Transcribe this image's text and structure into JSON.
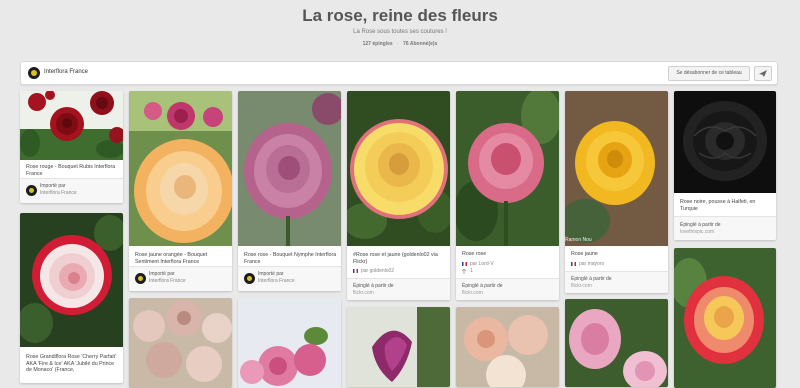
{
  "board": {
    "title": "La rose, reine des fleurs",
    "subtitle": "La Rose sous toutes ses coutures !",
    "pins_count": "127 épingles",
    "separator": "·",
    "followers_count": "76 Abonné(e)s"
  },
  "owner_bar": {
    "owner_name": "Interflora France",
    "unfollow_label": "Se désabonner de ce tableau",
    "send_icon": "paper-plane-icon"
  },
  "pins": [
    {
      "desc": "Rose rouge - Bouquet Rubis Interflora France",
      "foot_title": "Importé par",
      "foot_name": "Interflora France"
    },
    {
      "desc": "Rose Grandiflora Rose 'Cherry Parfait' AKA 'Fire & Ice' AKA 'Jubilé du Prince de Monaco' (France,"
    },
    {
      "desc": "Rose jaune orangée - Bouquet Sentiment Interflora France",
      "foot_title": "Importé par",
      "foot_name": "Interflora France"
    },
    {
      "desc": "Rose rose - Bouquet Nymphe Interflora France",
      "foot_title": "Importé par",
      "foot_name": "Interflora France"
    },
    {
      "desc": "#Rose rose et jaune (goldenlo02 via Flickr)",
      "by": "par goldenlo02",
      "foot_title": "Épinglé à partir de",
      "foot_name": "flickr.com"
    },
    {
      "desc": "Rose rose",
      "by": "par Lord-V",
      "count": "1",
      "foot_title": "Épinglé à partir de",
      "foot_name": "flickr.com"
    },
    {
      "desc": "Rose jaune",
      "by": "par mayoro",
      "foot_title": "Épinglé à partir de",
      "foot_name": "flickr.com",
      "watermark": "Ramon Nou"
    },
    {
      "desc": "Rose noire, pousse à Halfeti, en Turquie",
      "foot_title": "Épinglé à partir de",
      "foot_name": "lovethispic.com"
    }
  ],
  "colors": {
    "background": "#e9e9e9",
    "card": "#ffffff",
    "accent": "#d9c21c"
  }
}
